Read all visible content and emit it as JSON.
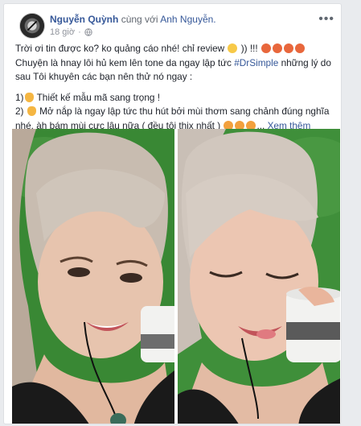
{
  "post": {
    "author": "Nguyễn Quỳnh",
    "with_text": "cùng với",
    "tagged": "Anh Nguyễn.",
    "time": "18 giờ",
    "privacy_icon": "globe-icon",
    "more_icon": "more-options-icon",
    "lines": {
      "l1_start": "Trời ơi tin được ko? ko quảng cáo nhé! chỉ review",
      "l1_end": ")) !!!",
      "l2_start": "Chuyện là hnay lôi hủ kem lên tone da ngay lập tức",
      "hashtag": "#DrSimple",
      "l2_end": "những lý do",
      "l3": "sau Tôi khuyên các bạn nên thử nó ngay :",
      "item1_start": "1)",
      "item1_text": "Thiết kế mẫu mã sang trọng !",
      "item2_start": "2)",
      "item2_text": "Mở nắp là ngay lập tức thu hút bởi mùi thơm sang chảnh đúng nghĩa",
      "item2_cont": "nhé, àh bám mùi cực lâu nữa ( đều tôi thix nhất )",
      "ellipsis": "...",
      "see_more": "Xem thêm"
    }
  },
  "colors": {
    "link": "#365899",
    "text": "#1d2129",
    "muted": "#90949c",
    "grass": "#3f8f3a"
  }
}
